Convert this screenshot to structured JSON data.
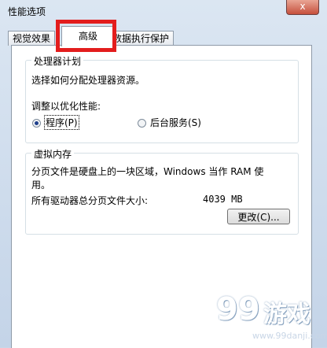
{
  "window": {
    "title": "性能选项",
    "close_glyph": "x"
  },
  "tabs": [
    {
      "label": "视觉效果",
      "active": false
    },
    {
      "label": "高级",
      "active": true
    },
    {
      "label": "数据执行保护",
      "active": false
    }
  ],
  "processor_group": {
    "title": "处理器计划",
    "description": "选择如何分配处理器资源。",
    "adjust_label": "调整以优化性能:",
    "options": [
      {
        "label": "程序(P)",
        "checked": true
      },
      {
        "label": "后台服务(S)",
        "checked": false
      }
    ]
  },
  "virtual_memory_group": {
    "title": "虚拟内存",
    "description": "分页文件是硬盘上的一块区域，Windows 当作 RAM 使用。",
    "desc_line1": "分页文件是硬盘上的一块区域，Windows 当作 RAM 使",
    "desc_line2": "用。",
    "total_label": "所有驱动器总分页文件大小:",
    "total_value": "4039 MB",
    "change_button": "更改(C)..."
  },
  "watermark": {
    "logo": "99",
    "name": "游戏",
    "url": "www.99danji.com"
  },
  "colors": {
    "highlight": "#e31d1d",
    "close_button": "#c6503d"
  }
}
